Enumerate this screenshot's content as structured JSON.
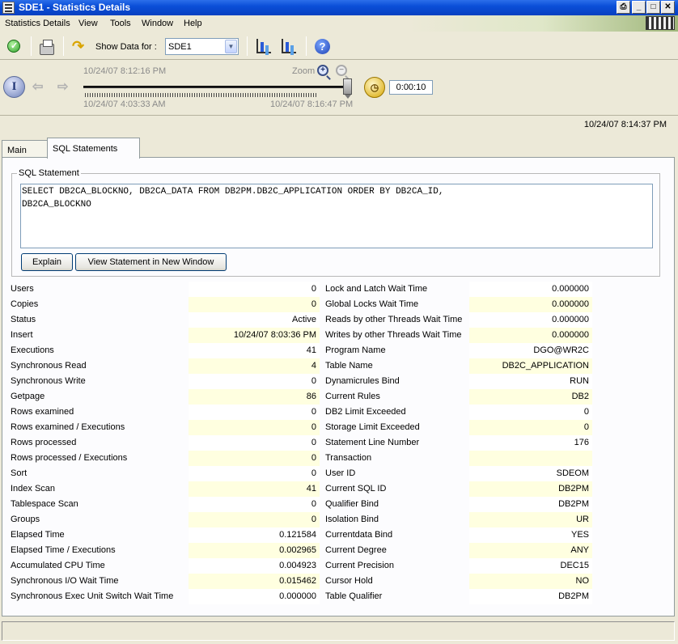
{
  "window": {
    "title": "SDE1 - Statistics Details"
  },
  "menu": [
    "Statistics Details",
    "View",
    "Tools",
    "Window",
    "Help"
  ],
  "toolbar": {
    "show_data_label": "Show Data for :",
    "subsystem_value": "SDE1"
  },
  "timeline": {
    "current_time": "10/24/07 8:12:16 PM",
    "zoom_label": "Zoom",
    "range_start": "10/24/07 4:03:33 AM",
    "range_end": "10/24/07 8:16:47 PM",
    "interval": "0:00:10"
  },
  "timestamp": "10/24/07 8:14:37 PM",
  "tabs": [
    {
      "label": "Main"
    },
    {
      "label": "SQL Statements"
    }
  ],
  "sql": {
    "group_label": "SQL Statement",
    "text": "SELECT DB2CA_BLOCKNO, DB2CA_DATA FROM DB2PM.DB2C_APPLICATION ORDER BY DB2CA_ID,\nDB2CA_BLOCKNO",
    "explain_label": "Explain",
    "view_new_window_label": "View Statement in New Window"
  },
  "left_stats": [
    {
      "label": "Users",
      "value": "0"
    },
    {
      "label": "Copies",
      "value": "0"
    },
    {
      "label": "Status",
      "value": "Active"
    },
    {
      "label": "Insert",
      "value": "10/24/07 8:03:36 PM"
    },
    {
      "label": "Executions",
      "value": "41"
    },
    {
      "label": "Synchronous Read",
      "value": "4"
    },
    {
      "label": "Synchronous Write",
      "value": "0"
    },
    {
      "label": "Getpage",
      "value": "86"
    },
    {
      "label": "Rows examined",
      "value": "0"
    },
    {
      "label": "Rows examined / Executions",
      "value": "0"
    },
    {
      "label": "Rows processed",
      "value": "0"
    },
    {
      "label": "Rows processed / Executions",
      "value": "0"
    },
    {
      "label": "Sort",
      "value": "0"
    },
    {
      "label": "Index Scan",
      "value": "41"
    },
    {
      "label": "Tablespace Scan",
      "value": "0"
    },
    {
      "label": "Groups",
      "value": "0"
    },
    {
      "label": "Elapsed Time",
      "value": "0.121584"
    },
    {
      "label": "Elapsed Time / Executions",
      "value": "0.002965"
    },
    {
      "label": "Accumulated CPU Time",
      "value": "0.004923"
    },
    {
      "label": "Synchronous I/O Wait Time",
      "value": "0.015462"
    },
    {
      "label": "Synchronous Exec Unit Switch Wait Time",
      "value": "0.000000"
    }
  ],
  "right_stats": [
    {
      "label": "Lock and Latch Wait Time",
      "value": "0.000000"
    },
    {
      "label": "Global Locks Wait Time",
      "value": "0.000000"
    },
    {
      "label": "Reads by other Threads Wait Time",
      "value": "0.000000"
    },
    {
      "label": "Writes by other Threads Wait Time",
      "value": "0.000000"
    },
    {
      "label": "Program Name",
      "value": "DGO@WR2C"
    },
    {
      "label": "Table Name",
      "value": "DB2C_APPLICATION"
    },
    {
      "label": "Dynamicrules Bind",
      "value": "RUN"
    },
    {
      "label": "Current Rules",
      "value": "DB2"
    },
    {
      "label": "DB2 Limit Exceeded",
      "value": "0"
    },
    {
      "label": "Storage Limit Exceeded",
      "value": "0"
    },
    {
      "label": "Statement Line Number",
      "value": "176"
    },
    {
      "label": "Transaction",
      "value": ""
    },
    {
      "label": "User ID",
      "value": "SDEOM"
    },
    {
      "label": "Current SQL ID",
      "value": "DB2PM"
    },
    {
      "label": "Qualifier Bind",
      "value": "DB2PM"
    },
    {
      "label": "Isolation Bind",
      "value": "UR"
    },
    {
      "label": "Currentdata Bind",
      "value": "YES"
    },
    {
      "label": "Current Degree",
      "value": "ANY"
    },
    {
      "label": "Current Precision",
      "value": "DEC15"
    },
    {
      "label": "Cursor Hold",
      "value": "NO"
    },
    {
      "label": "Table Qualifier",
      "value": "DB2PM"
    }
  ]
}
